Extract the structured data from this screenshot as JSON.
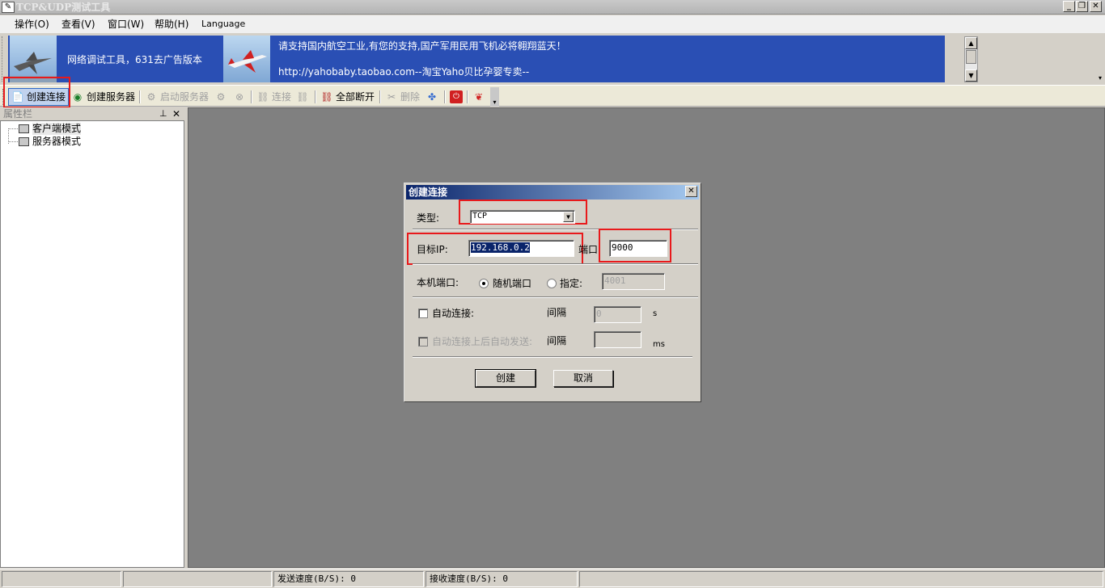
{
  "app": {
    "title": "TCP&UDP测试工具"
  },
  "menu": {
    "items": [
      "操作(O)",
      "查看(V)",
      "窗口(W)",
      "帮助(H)",
      "Language"
    ]
  },
  "banner": {
    "left_text": "网络调试工具，631去广告版本",
    "line1": "请支持国内航空工业,有您的支持,国产军用民用飞机必将翱翔蓝天！",
    "line2": "http://yahobaby.taobao.com--淘宝Yaho贝比孕婴专卖--"
  },
  "toolbar": {
    "create_connection": "创建连接",
    "create_server": "创建服务器",
    "start_server": "启动服务器",
    "connect": "连接",
    "disconnect_all": "全部断开",
    "delete": "删除"
  },
  "panel": {
    "title": "属性栏",
    "items": [
      "客户端模式",
      "服务器模式"
    ]
  },
  "dialog": {
    "title": "创建连接",
    "type_label": "类型:",
    "type_value": "TCP",
    "ip_label": "目标IP:",
    "ip_value": "192.168.0.2",
    "port_label": "端口",
    "port_value": "9000",
    "local_port_label": "本机端口:",
    "random_port_label": "随机端口",
    "specify_label": "指定:",
    "specify_value": "4001",
    "auto_connect_label": "自动连接:",
    "interval_label": "间隔",
    "auto_connect_value": "0",
    "unit_s": "s",
    "auto_send_label": "自动连接上后自动发送:",
    "interval_label2": "间隔",
    "auto_send_value": "",
    "unit_ms": "ms",
    "create_button": "创建",
    "cancel_button": "取消"
  },
  "status": {
    "send_speed": "发送速度(B/S): 0",
    "recv_speed": "接收速度(B/S): 0"
  },
  "colors": {
    "highlight": "#e8191b",
    "banner_bg": "#2a4fb4",
    "mdi_bg": "#808080"
  }
}
